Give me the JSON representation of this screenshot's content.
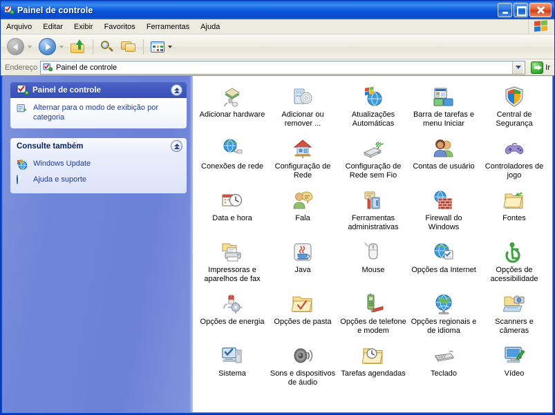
{
  "window": {
    "title": "Painel de controle",
    "title_icon": "control-panel-icon",
    "minimize_label": "Minimizar",
    "maximize_label": "Maximizar",
    "close_label": "Fechar"
  },
  "menu": {
    "items": [
      {
        "label": "Arquivo"
      },
      {
        "label": "Editar"
      },
      {
        "label": "Exibir"
      },
      {
        "label": "Favoritos"
      },
      {
        "label": "Ferramentas"
      },
      {
        "label": "Ajuda"
      }
    ],
    "brand_icon": "windows-flag-icon"
  },
  "toolbar": {
    "back": {
      "label": "Voltar",
      "icon": "back-arrow-icon",
      "enabled": false
    },
    "forward": {
      "label": "Avançar",
      "icon": "forward-arrow-icon",
      "enabled": true
    },
    "up": {
      "label": "Acima",
      "icon": "up-folder-icon"
    },
    "search": {
      "label": "Pesquisar",
      "icon": "search-icon"
    },
    "folders": {
      "label": "Pastas",
      "icon": "folders-icon"
    },
    "views": {
      "label": "Modos de exibição",
      "icon": "views-icon"
    }
  },
  "address": {
    "label": "Endereço",
    "value": "Painel de controle",
    "icon": "control-panel-icon",
    "go_label": "Ir",
    "go_icon": "go-arrow-icon"
  },
  "sidebar": {
    "panels": [
      {
        "title": "Painel de controle",
        "header_icon": "control-panel-icon",
        "collapse_icon": "chevron-up-icon",
        "links": [
          {
            "label": "Alternar para o modo de exibição por categoria",
            "icon": "switch-view-icon"
          }
        ]
      },
      {
        "title": "Consulte também",
        "collapse_icon": "chevron-up-icon",
        "links": [
          {
            "label": "Windows Update",
            "icon": "windows-update-icon"
          },
          {
            "label": "Ajuda e suporte",
            "icon": "help-icon"
          }
        ]
      }
    ]
  },
  "content": {
    "items": [
      {
        "label": "Adicionar hardware",
        "icon": "add-hardware-icon"
      },
      {
        "label": "Adicionar ou remover ...",
        "icon": "add-remove-programs-icon"
      },
      {
        "label": "Atualizações Automáticas",
        "icon": "automatic-updates-icon"
      },
      {
        "label": "Barra de tarefas e menu Iniciar",
        "icon": "taskbar-startmenu-icon"
      },
      {
        "label": "Central de Segurança",
        "icon": "security-center-icon"
      },
      {
        "label": "Conexões de rede",
        "icon": "network-connections-icon"
      },
      {
        "label": "Configuração de Rede",
        "icon": "network-setup-icon"
      },
      {
        "label": "Configuração de Rede sem Fio",
        "icon": "wireless-network-setup-icon"
      },
      {
        "label": "Contas de usuário",
        "icon": "user-accounts-icon"
      },
      {
        "label": "Controladores de jogo",
        "icon": "game-controllers-icon"
      },
      {
        "label": "Data e hora",
        "icon": "date-time-icon"
      },
      {
        "label": "Fala",
        "icon": "speech-icon"
      },
      {
        "label": "Ferramentas administrativas",
        "icon": "administrative-tools-icon"
      },
      {
        "label": "Firewall do Windows",
        "icon": "windows-firewall-icon"
      },
      {
        "label": "Fontes",
        "icon": "fonts-icon"
      },
      {
        "label": "Impressoras e aparelhos de fax",
        "icon": "printers-faxes-icon"
      },
      {
        "label": "Java",
        "icon": "java-icon"
      },
      {
        "label": "Mouse",
        "icon": "mouse-icon"
      },
      {
        "label": "Opções da Internet",
        "icon": "internet-options-icon"
      },
      {
        "label": "Opções de acessibilidade",
        "icon": "accessibility-options-icon"
      },
      {
        "label": "Opções de energia",
        "icon": "power-options-icon"
      },
      {
        "label": "Opções de pasta",
        "icon": "folder-options-icon"
      },
      {
        "label": "Opções de telefone e modem",
        "icon": "phone-modem-options-icon"
      },
      {
        "label": "Opções regionais e de idioma",
        "icon": "regional-language-options-icon"
      },
      {
        "label": "Scanners e câmeras",
        "icon": "scanners-cameras-icon"
      },
      {
        "label": "Sistema",
        "icon": "system-icon"
      },
      {
        "label": "Sons e dispositivos de áudio",
        "icon": "sounds-audio-devices-icon"
      },
      {
        "label": "Tarefas agendadas",
        "icon": "scheduled-tasks-icon"
      },
      {
        "label": "Teclado",
        "icon": "keyboard-icon"
      },
      {
        "label": "Vídeo",
        "icon": "display-icon"
      }
    ]
  },
  "colors": {
    "titlebar_blue": "#0A52D8",
    "sidebar_blue": "#6F86D8",
    "panel_header_blue": "#3F57BE",
    "link_blue": "#1F3A93",
    "close_red": "#E85C30",
    "go_green": "#2E9B3C"
  }
}
